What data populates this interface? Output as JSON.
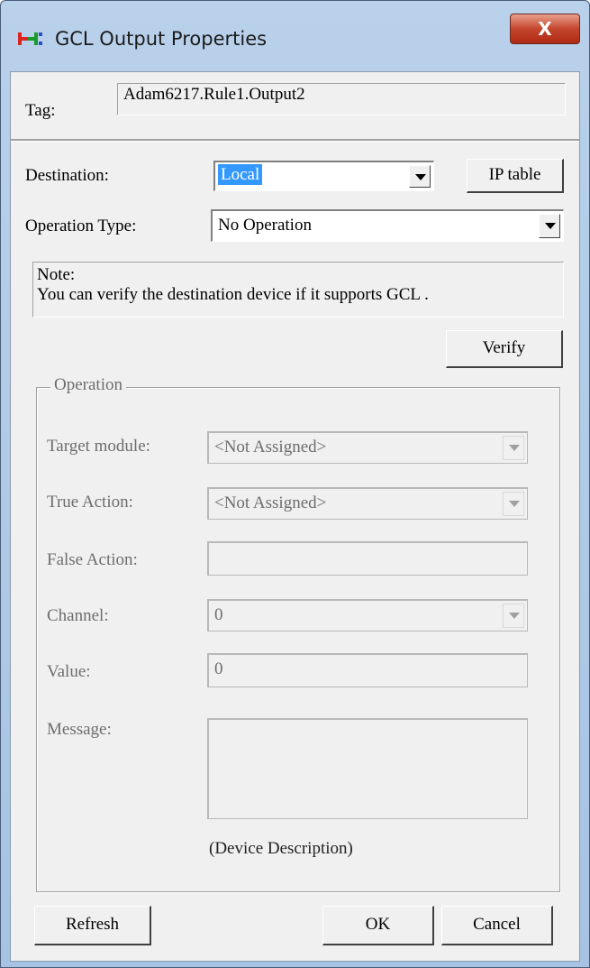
{
  "window": {
    "title": "GCL Output Properties",
    "close_label": "X"
  },
  "tag": {
    "label": "Tag:",
    "value": "Adam6217.Rule1.Output2"
  },
  "destination": {
    "label": "Destination:",
    "value": "Local",
    "ip_table_button": "IP table"
  },
  "operation_type": {
    "label": "Operation Type:",
    "value": "No Operation"
  },
  "note": {
    "line1": "Note:",
    "line2": "You can verify the destination device if it supports GCL ."
  },
  "verify_button": "Verify",
  "operation": {
    "group_label": "Operation",
    "target_module": {
      "label": "Target module:",
      "value": "<Not Assigned>"
    },
    "true_action": {
      "label": "True Action:",
      "value": "<Not Assigned>"
    },
    "false_action": {
      "label": "False Action:",
      "value": ""
    },
    "channel": {
      "label": "Channel:",
      "value": "0"
    },
    "value": {
      "label": "Value:",
      "value": "0"
    },
    "message": {
      "label": "Message:",
      "value": ""
    },
    "device_description": "(Device Description)"
  },
  "buttons": {
    "refresh": "Refresh",
    "ok": "OK",
    "cancel": "Cancel"
  }
}
